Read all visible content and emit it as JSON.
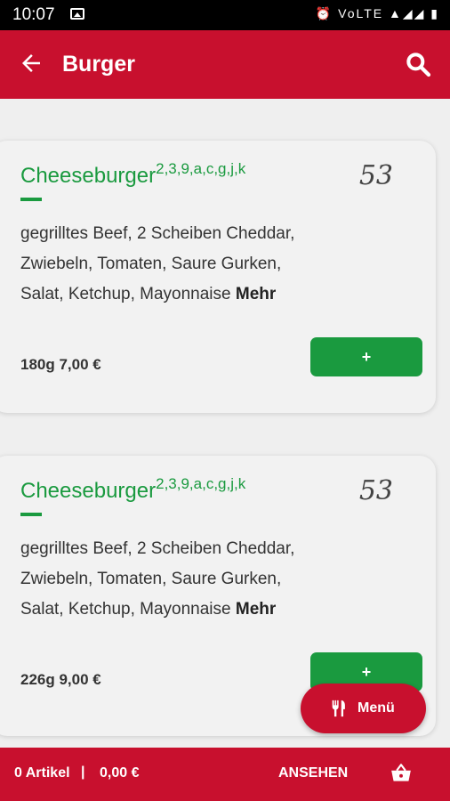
{
  "status": {
    "time": "10:07",
    "icons": "⏰ VoLTE ▲◢◢ ▮"
  },
  "appbar": {
    "title": "Burger"
  },
  "products": [
    {
      "name": "Cheeseburger",
      "allergens": "2,3,9,a,c,g,j,k",
      "number": "53",
      "description": "gegrilltes Beef, 2 Scheiben Cheddar, Zwiebeln, Tomaten, Saure Gurken, Salat, Ketchup, Mayonnaise",
      "more": "Mehr",
      "price": "180g 7,00 €",
      "add": "+"
    },
    {
      "name": "Cheeseburger",
      "allergens": "2,3,9,a,c,g,j,k",
      "number": "53",
      "description": "gegrilltes Beef, 2 Scheiben Cheddar, Zwiebeln, Tomaten, Saure Gurken, Salat, Ketchup, Mayonnaise",
      "more": "Mehr",
      "price": "226g 9,00 €",
      "add": "+"
    }
  ],
  "menu_fab": {
    "label": "Menü"
  },
  "bottom": {
    "count": "0 Artikel",
    "separator": "|",
    "total": "0,00 €",
    "view": "ANSEHEN"
  },
  "colors": {
    "brand": "#c8102e",
    "accent": "#1a9a3f"
  }
}
